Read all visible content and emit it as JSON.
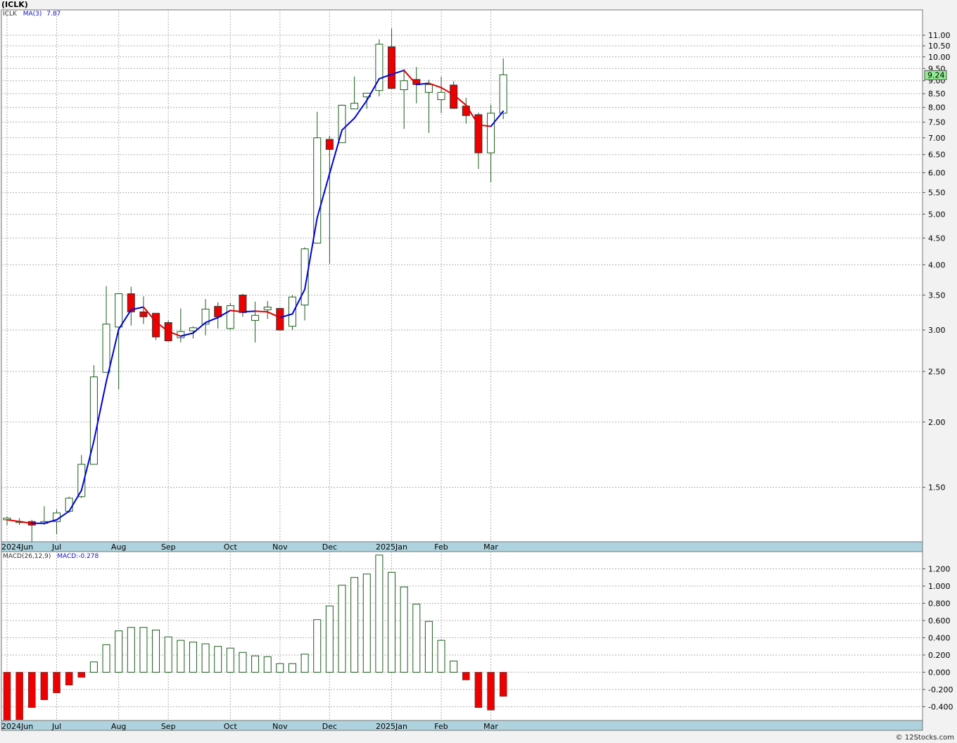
{
  "header": {
    "title": "(ICLK)"
  },
  "price_legend": {
    "symbol": "ICLK",
    "ma_label": "MA(3)",
    "ma_value": "7.87"
  },
  "macd_legend": {
    "label": "MACD(26,12,9)",
    "value_label": "MACD:-0.278"
  },
  "last_price_label": "9.24",
  "credit": "© 12Stocks.com",
  "colors": {
    "up": "#ffffff",
    "down": "#ee0000",
    "wick": "#1a5c1a",
    "ma_up": "#0000dd",
    "ma_down": "#dd0000",
    "macd_pos": "#1a5c1a",
    "axis_band": "#aed3de",
    "last_price_box": "#90ee90"
  },
  "chart_data": [
    {
      "type": "candlestick",
      "scale": "log",
      "ylim": [
        1.18,
        12.3
      ],
      "y_ticks": [
        "11.00",
        "10.50",
        "10.00",
        "9.50",
        "9.00",
        "8.50",
        "8.00",
        "7.50",
        "7.00",
        "6.50",
        "6.00",
        "5.50",
        "5.00",
        "4.50",
        "4.00",
        "3.50",
        "3.00",
        "2.50",
        "2.00",
        "1.50"
      ],
      "x_labels": [
        "2024Jun",
        "Jul",
        "Aug",
        "Sep",
        "Oct",
        "Nov",
        "Dec",
        "2025Jan",
        "Feb",
        "Mar"
      ],
      "candles": [
        {
          "o": 1.3,
          "h": 1.32,
          "l": 1.27,
          "c": 1.31
        },
        {
          "o": 1.29,
          "h": 1.31,
          "l": 1.27,
          "c": 1.29
        },
        {
          "o": 1.29,
          "h": 1.3,
          "l": 1.18,
          "c": 1.27
        },
        {
          "o": 1.28,
          "h": 1.38,
          "l": 1.27,
          "c": 1.29
        },
        {
          "o": 1.29,
          "h": 1.36,
          "l": 1.22,
          "c": 1.34
        },
        {
          "o": 1.35,
          "h": 1.44,
          "l": 1.34,
          "c": 1.43
        },
        {
          "o": 1.44,
          "h": 1.73,
          "l": 1.43,
          "c": 1.66
        },
        {
          "o": 1.66,
          "h": 2.57,
          "l": 1.66,
          "c": 2.44
        },
        {
          "o": 2.49,
          "h": 3.64,
          "l": 2.49,
          "c": 3.08
        },
        {
          "o": 3.04,
          "h": 3.52,
          "l": 2.31,
          "c": 3.52
        },
        {
          "o": 3.52,
          "h": 3.63,
          "l": 3.06,
          "c": 3.25
        },
        {
          "o": 3.25,
          "h": 3.48,
          "l": 3.08,
          "c": 3.18
        },
        {
          "o": 3.23,
          "h": 3.23,
          "l": 2.87,
          "c": 2.91
        },
        {
          "o": 3.1,
          "h": 3.13,
          "l": 2.85,
          "c": 2.86
        },
        {
          "o": 2.9,
          "h": 3.3,
          "l": 2.84,
          "c": 2.98
        },
        {
          "o": 2.99,
          "h": 3.05,
          "l": 2.89,
          "c": 3.03
        },
        {
          "o": 3.08,
          "h": 3.44,
          "l": 2.93,
          "c": 3.29
        },
        {
          "o": 3.33,
          "h": 3.39,
          "l": 3.02,
          "c": 3.18
        },
        {
          "o": 3.02,
          "h": 3.38,
          "l": 3.0,
          "c": 3.34
        },
        {
          "o": 3.5,
          "h": 3.52,
          "l": 3.18,
          "c": 3.24
        },
        {
          "o": 3.13,
          "h": 3.4,
          "l": 2.84,
          "c": 3.2
        },
        {
          "o": 3.28,
          "h": 3.41,
          "l": 3.15,
          "c": 3.32
        },
        {
          "o": 3.3,
          "h": 3.31,
          "l": 3.0,
          "c": 3.0
        },
        {
          "o": 3.05,
          "h": 3.5,
          "l": 3.0,
          "c": 3.47
        },
        {
          "o": 3.35,
          "h": 4.32,
          "l": 3.13,
          "c": 4.29
        },
        {
          "o": 4.4,
          "h": 7.85,
          "l": 4.4,
          "c": 7.0
        },
        {
          "o": 6.95,
          "h": 7.06,
          "l": 4.02,
          "c": 6.65
        },
        {
          "o": 6.85,
          "h": 8.1,
          "l": 6.85,
          "c": 8.08
        },
        {
          "o": 7.95,
          "h": 9.17,
          "l": 7.95,
          "c": 8.15
        },
        {
          "o": 8.38,
          "h": 8.52,
          "l": 7.95,
          "c": 8.52
        },
        {
          "o": 8.62,
          "h": 10.8,
          "l": 8.4,
          "c": 10.57
        },
        {
          "o": 10.45,
          "h": 11.33,
          "l": 8.68,
          "c": 8.7
        },
        {
          "o": 8.65,
          "h": 9.48,
          "l": 7.28,
          "c": 9.0
        },
        {
          "o": 9.05,
          "h": 9.56,
          "l": 8.15,
          "c": 8.85
        },
        {
          "o": 8.55,
          "h": 9.04,
          "l": 7.15,
          "c": 8.85
        },
        {
          "o": 8.28,
          "h": 9.16,
          "l": 7.8,
          "c": 8.55
        },
        {
          "o": 8.83,
          "h": 8.98,
          "l": 7.95,
          "c": 7.97
        },
        {
          "o": 8.05,
          "h": 8.35,
          "l": 7.45,
          "c": 7.72
        },
        {
          "o": 7.75,
          "h": 7.82,
          "l": 6.1,
          "c": 6.55
        },
        {
          "o": 6.55,
          "h": 8.1,
          "l": 5.75,
          "c": 7.8
        },
        {
          "o": 7.8,
          "h": 9.93,
          "l": 7.6,
          "c": 9.24
        }
      ],
      "ma3": [
        1.3,
        1.29,
        1.28,
        1.28,
        1.3,
        1.35,
        1.48,
        1.84,
        2.39,
        3.01,
        3.28,
        3.32,
        3.11,
        2.98,
        2.92,
        2.96,
        3.1,
        3.17,
        3.27,
        3.25,
        3.26,
        3.25,
        3.17,
        3.22,
        3.59,
        4.92,
        5.98,
        7.24,
        7.63,
        8.25,
        9.08,
        9.26,
        9.42,
        8.85,
        8.9,
        8.73,
        8.46,
        8.08,
        7.41,
        7.36,
        7.87
      ]
    },
    {
      "type": "bar",
      "name": "MACD(26,12,9)",
      "ylim": [
        -0.56,
        1.4
      ],
      "y_ticks": [
        "1.200",
        "1.000",
        "0.800",
        "0.600",
        "0.400",
        "0.200",
        "0.000",
        "-0.200",
        "-0.400"
      ],
      "x_labels": [
        "2024Jun",
        "Jul",
        "Aug",
        "Sep",
        "Oct",
        "Nov",
        "Dec",
        "2025Jan",
        "Feb",
        "Mar"
      ],
      "values": [
        -0.58,
        -0.55,
        -0.41,
        -0.32,
        -0.24,
        -0.15,
        -0.06,
        0.12,
        0.32,
        0.48,
        0.52,
        0.52,
        0.49,
        0.41,
        0.37,
        0.35,
        0.33,
        0.3,
        0.28,
        0.23,
        0.19,
        0.18,
        0.1,
        0.1,
        0.21,
        0.61,
        0.77,
        1.01,
        1.1,
        1.14,
        1.36,
        1.16,
        0.99,
        0.79,
        0.59,
        0.37,
        0.13,
        -0.09,
        -0.41,
        -0.44,
        -0.28
      ]
    }
  ]
}
